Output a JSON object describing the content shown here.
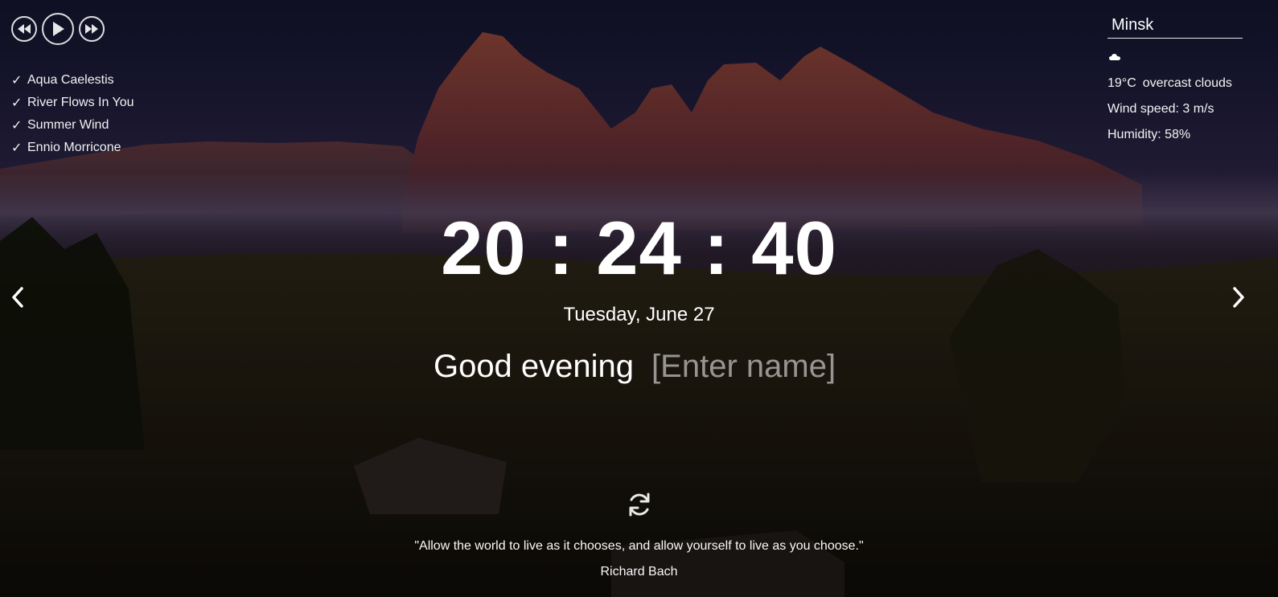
{
  "player": {
    "prev_icon": "rewind-icon",
    "play_icon": "play-icon",
    "next_icon": "fast-forward-icon"
  },
  "playlist": [
    {
      "title": "Aqua Caelestis"
    },
    {
      "title": "River Flows In You"
    },
    {
      "title": "Summer Wind"
    },
    {
      "title": "Ennio Morricone"
    }
  ],
  "weather": {
    "city": "Minsk",
    "icon": "cloud-icon",
    "temperature": "19°C",
    "description": "overcast clouds",
    "wind": "Wind speed: 3 m/s",
    "humidity": "Humidity: 58%"
  },
  "slider": {
    "prev_icon": "chevron-left-icon",
    "next_icon": "chevron-right-icon"
  },
  "clock": {
    "time": "20 : 24 : 40",
    "date": "Tuesday, June 27"
  },
  "greeting": {
    "text": "Good evening",
    "name_placeholder": "[Enter name]"
  },
  "quote": {
    "refresh_icon": "refresh-icon",
    "text": "\"Allow the world to live as it chooses, and allow yourself to live as you choose.\"",
    "author": "Richard Bach"
  },
  "colors": {
    "text": "#ffffff",
    "sky_top": "#14152e",
    "mountain": "#7a3a35",
    "ground": "#120f0b"
  }
}
